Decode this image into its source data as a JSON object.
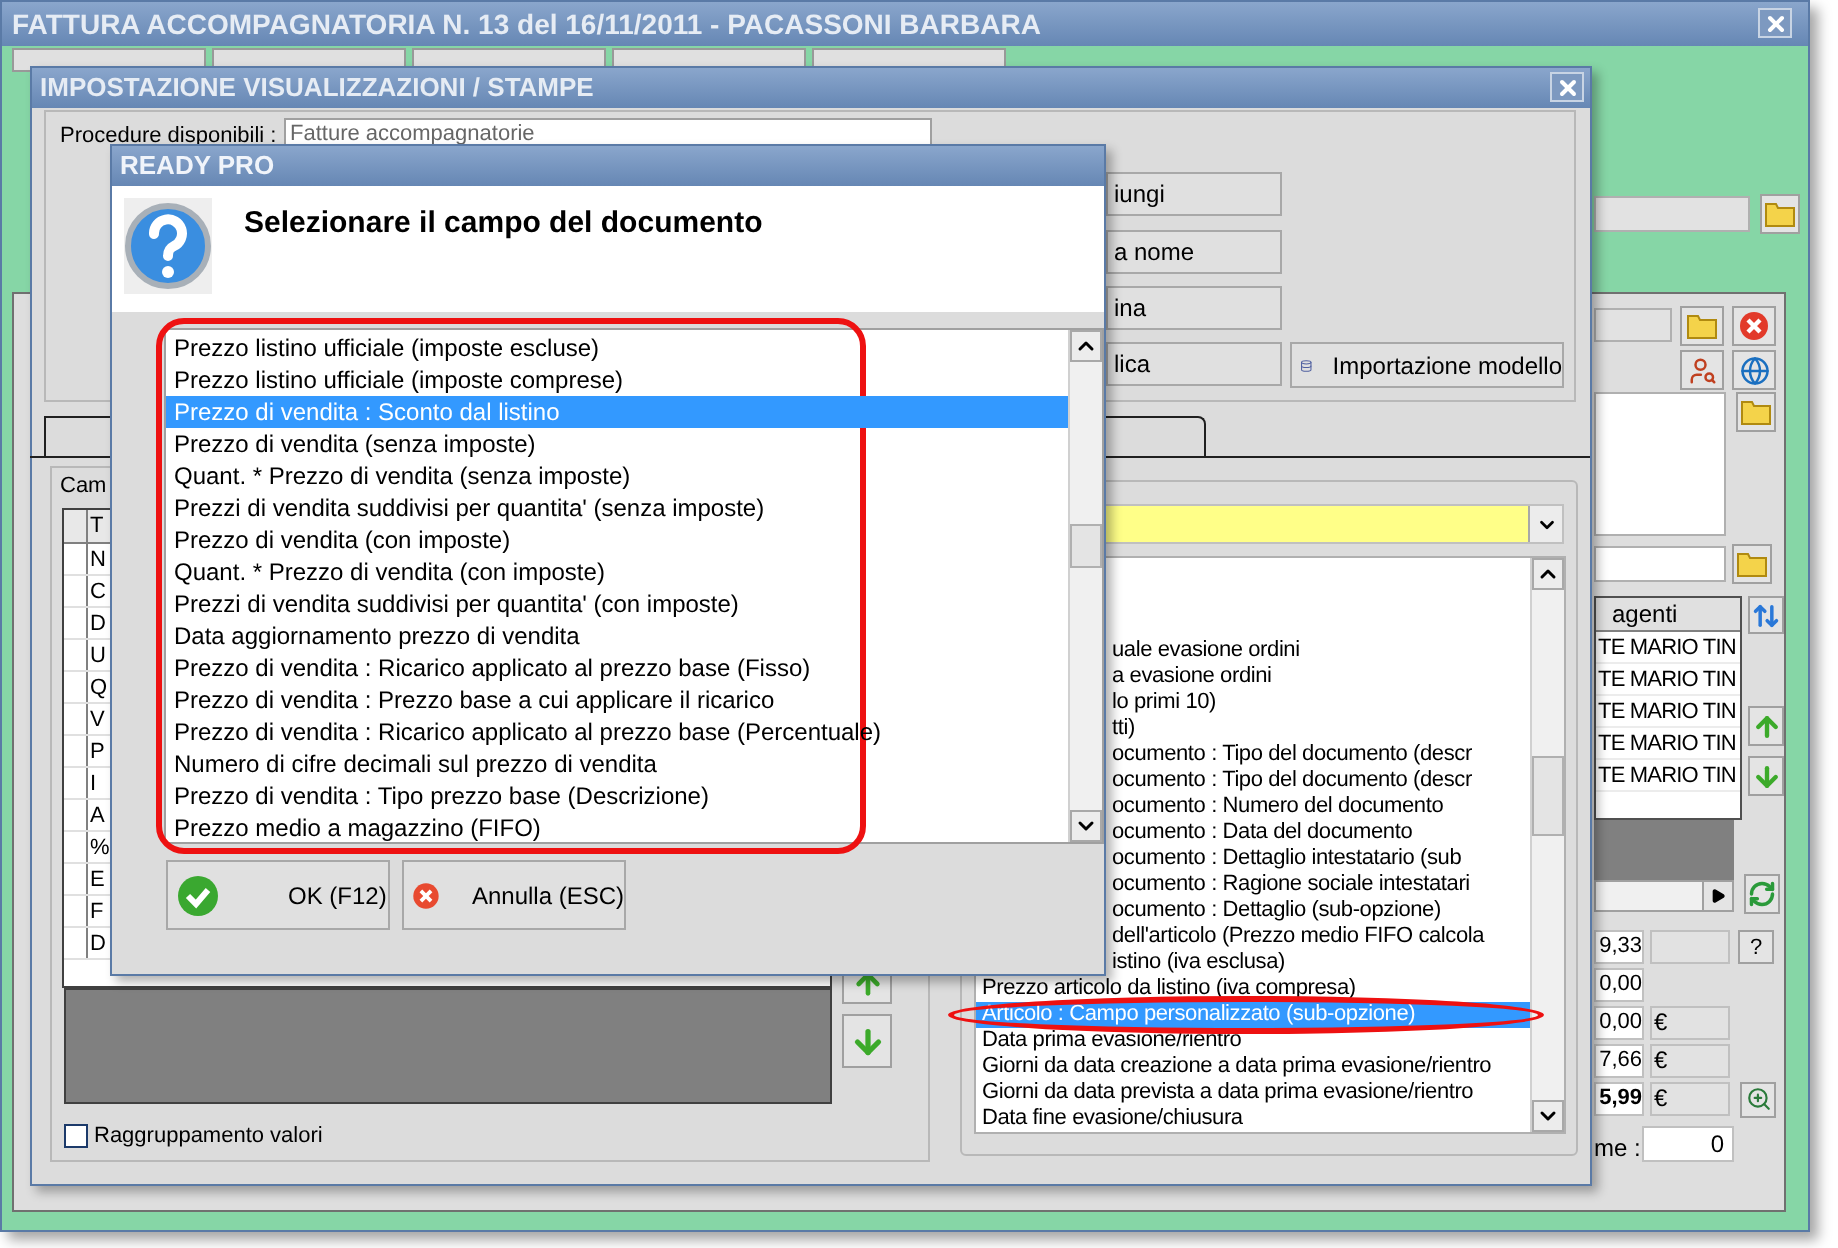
{
  "main_window": {
    "title": "FATTURA ACCOMPAGNATORIA N. 13 del 16/11/2011 - PACASSONI BARBARA",
    "tabs": [
      {
        "selected": false
      },
      {
        "selected": false
      },
      {
        "selected": false
      },
      {
        "selected": false
      },
      {
        "selected": false
      }
    ],
    "agents_table": {
      "header": "agenti",
      "rows": [
        "TE MARIO TIN",
        "TE MARIO TIN",
        "TE MARIO TIN",
        "TE MARIO TIN",
        "TE MARIO TIN"
      ]
    },
    "totals": [
      {
        "value": "9,33",
        "kind": "help"
      },
      {
        "value": "0,00",
        "kind": "plain"
      },
      {
        "value": "0,00",
        "currency": "€",
        "kind": "plain"
      },
      {
        "value": "7,66",
        "currency": "€",
        "kind": "plain"
      },
      {
        "value": "5,99",
        "currency": "€",
        "kind": "zoom"
      }
    ],
    "help_button": "?",
    "counter_label": "me :",
    "counter_value": "0"
  },
  "settings_window": {
    "title": "IMPOSTAZIONE VISUALIZZAZIONI / STAMPE",
    "procedure_label": "Procedure disponibili :",
    "procedure_value": "Fatture accompagnatorie",
    "side_buttons": [
      "iungi",
      "a nome",
      "ina",
      "lica"
    ],
    "import_button": "Importazione modello",
    "tabs": [
      {
        "selected": true
      }
    ],
    "fields_label": "Cam",
    "table": {
      "header": "T",
      "rows": [
        "N",
        "C",
        "D",
        "U",
        "Q",
        "V",
        "P",
        "I",
        "A",
        "%",
        "E",
        "F",
        "D"
      ]
    },
    "grouping": {
      "label": "Raggruppamento valori",
      "checked": false
    },
    "field_list": [
      {
        "label": "uale evasione ordini",
        "selected": false,
        "kind": "cut"
      },
      {
        "label": "a evasione ordini",
        "selected": false,
        "kind": "cut"
      },
      {
        "label": "lo primi 10)",
        "selected": false,
        "kind": "cut"
      },
      {
        "label": "tti)",
        "selected": false,
        "kind": "cut"
      },
      {
        "label": "ocumento : Tipo del documento (descr",
        "selected": false,
        "kind": "cut"
      },
      {
        "label": "ocumento : Tipo del documento (descr",
        "selected": false,
        "kind": "cut"
      },
      {
        "label": "ocumento : Numero del documento",
        "selected": false,
        "kind": "cut"
      },
      {
        "label": "ocumento : Data del documento",
        "selected": false,
        "kind": "cut"
      },
      {
        "label": "ocumento : Dettaglio intestatario (sub",
        "selected": false,
        "kind": "cut"
      },
      {
        "label": "ocumento : Ragione sociale intestatari",
        "selected": false,
        "kind": "cut"
      },
      {
        "label": "ocumento : Dettaglio (sub-opzione)",
        "selected": false,
        "kind": "cut"
      },
      {
        "label": "dell'articolo (Prezzo medio FIFO calcola",
        "selected": false,
        "kind": "cut"
      },
      {
        "label": "istino (iva esclusa)",
        "selected": false,
        "kind": "cut"
      },
      {
        "label": "Prezzo articolo da listino (iva compresa)",
        "selected": false,
        "kind": "whole"
      },
      {
        "label": "Articolo : Campo personalizzato (sub-opzione)",
        "selected": true,
        "kind": "whole"
      },
      {
        "label": "Data prima evasione/rientro",
        "selected": false,
        "kind": "whole"
      },
      {
        "label": "Giorni da data creazione a data prima evasione/rientro",
        "selected": false,
        "kind": "whole"
      },
      {
        "label": "Giorni da data prevista a data prima evasione/rientro",
        "selected": false,
        "kind": "whole"
      },
      {
        "label": "Data fine evasione/chiusura",
        "selected": false,
        "kind": "whole"
      }
    ]
  },
  "dialog": {
    "title": "READY PRO",
    "prompt": "Selezionare il campo del documento",
    "options": [
      {
        "label": "Prezzo listino ufficiale (imposte escluse)",
        "selected": false
      },
      {
        "label": "Prezzo listino ufficiale (imposte comprese)",
        "selected": false
      },
      {
        "label": "Prezzo di vendita : Sconto dal listino",
        "selected": true
      },
      {
        "label": "Prezzo di vendita (senza imposte)",
        "selected": false
      },
      {
        "label": "Quant. * Prezzo di vendita (senza imposte)",
        "selected": false
      },
      {
        "label": "Prezzi di vendita suddivisi per quantita' (senza imposte)",
        "selected": false
      },
      {
        "label": "Prezzo di vendita (con imposte)",
        "selected": false
      },
      {
        "label": "Quant. * Prezzo di vendita (con imposte)",
        "selected": false
      },
      {
        "label": "Prezzi di vendita suddivisi per quantita' (con imposte)",
        "selected": false
      },
      {
        "label": "Data aggiornamento prezzo di vendita",
        "selected": false
      },
      {
        "label": "Prezzo di vendita : Ricarico applicato al prezzo base (Fisso)",
        "selected": false
      },
      {
        "label": "Prezzo di vendita : Prezzo base a cui applicare il ricarico",
        "selected": false
      },
      {
        "label": "Prezzo di vendita : Ricarico applicato al prezzo base (Percentuale)",
        "selected": false
      },
      {
        "label": "Numero di cifre decimali sul prezzo di vendita",
        "selected": false
      },
      {
        "label": "Prezzo di vendita : Tipo prezzo base (Descrizione)",
        "selected": false
      },
      {
        "label": "Prezzo medio a magazzino (FIFO)",
        "selected": false
      }
    ],
    "buttons": [
      {
        "label": "OK (F12)",
        "kind": "ok"
      },
      {
        "label": "Annulla (ESC)",
        "kind": "cancel"
      }
    ]
  }
}
